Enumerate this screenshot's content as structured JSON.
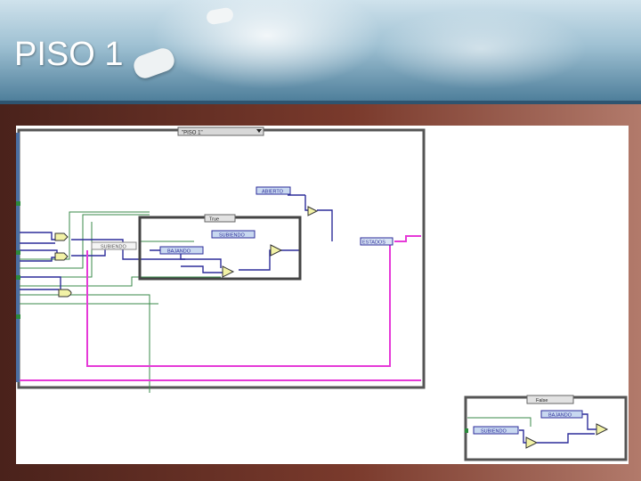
{
  "slide": {
    "title": "PISO 1"
  },
  "diagram_main": {
    "case_selector": "\"PISO 1\"",
    "enum_abierto": "ABIERTO",
    "inner_case_selector": "True",
    "enum_subiendo": "SUBIENDO",
    "enum_subiendo_small": "SUBIENDO",
    "enum_bajando": "BAJANDO",
    "enum_estados": "ESTADOS"
  },
  "diagram_small": {
    "case_selector": "False",
    "enum_bajando": "BAJANDO",
    "enum_subiendo": "SUBIENDO"
  },
  "colors": {
    "wire_green": "#3a8a4a",
    "wire_blue": "#2d2d9a",
    "wire_pink": "#e63ad8"
  }
}
